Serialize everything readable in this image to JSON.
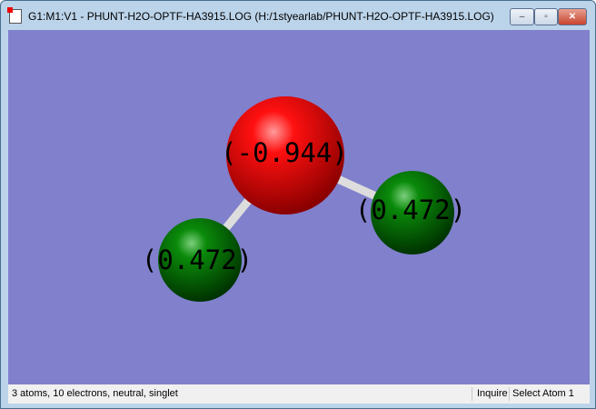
{
  "window": {
    "title": "G1:M1:V1 - PHUNT-H2O-OPTF-HA3915.LOG (H:/1styearlab/PHUNT-H2O-OPTF-HA3915.LOG)",
    "minimize": "‒",
    "maximize": "▫",
    "close": "✕"
  },
  "molecule": {
    "atoms": [
      {
        "element": "O",
        "charge_label": "(-0.944)",
        "color": "#ff0000"
      },
      {
        "element": "H",
        "charge_label": "(0.472)",
        "color": "#008000"
      },
      {
        "element": "H",
        "charge_label": "(0.472)",
        "color": "#008000"
      }
    ]
  },
  "status": {
    "info": "3 atoms, 10 electrons, neutral, singlet",
    "mode": "Inquire",
    "action": "Select Atom 1"
  }
}
